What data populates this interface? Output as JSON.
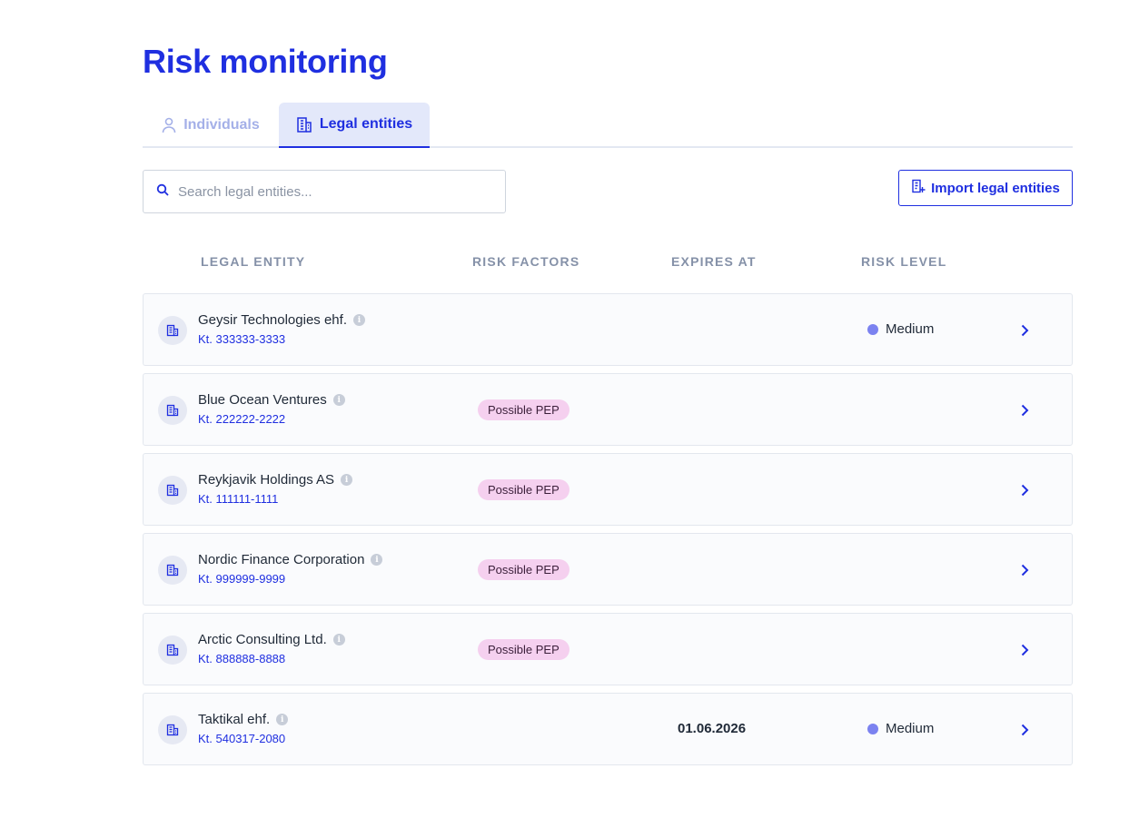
{
  "page": {
    "title": "Risk monitoring"
  },
  "tabs": [
    {
      "label": "Individuals",
      "icon": "person-icon",
      "active": false
    },
    {
      "label": "Legal entities",
      "icon": "building-icon",
      "active": true
    }
  ],
  "search": {
    "placeholder": "Search legal entities...",
    "value": ""
  },
  "toolbar": {
    "import_label": "Import legal entities"
  },
  "table": {
    "columns": [
      "LEGAL ENTITY",
      "RISK FACTORS",
      "EXPIRES AT",
      "RISK LEVEL"
    ],
    "rows": [
      {
        "name": "Geysir Technologies ehf.",
        "kt": "Kt. 333333-3333",
        "risk_factor": "",
        "expires": "",
        "risk_level": "Medium"
      },
      {
        "name": "Blue Ocean Ventures",
        "kt": "Kt. 222222-2222",
        "risk_factor": "Possible PEP",
        "expires": "",
        "risk_level": ""
      },
      {
        "name": "Reykjavik Holdings AS",
        "kt": "Kt. 111111-1111",
        "risk_factor": "Possible PEP",
        "expires": "",
        "risk_level": ""
      },
      {
        "name": "Nordic Finance Corporation",
        "kt": "Kt. 999999-9999",
        "risk_factor": "Possible PEP",
        "expires": "",
        "risk_level": ""
      },
      {
        "name": "Arctic Consulting Ltd.",
        "kt": "Kt. 888888-8888",
        "risk_factor": "Possible PEP",
        "expires": "",
        "risk_level": ""
      },
      {
        "name": "Taktikal ehf.",
        "kt": "Kt. 540317-2080",
        "risk_factor": "",
        "expires": "01.06.2026",
        "risk_level": "Medium"
      }
    ]
  },
  "colors": {
    "accent": "#1f2fe0",
    "pep_badge": "#f5d0ef",
    "medium_dot": "#7b82f0"
  }
}
